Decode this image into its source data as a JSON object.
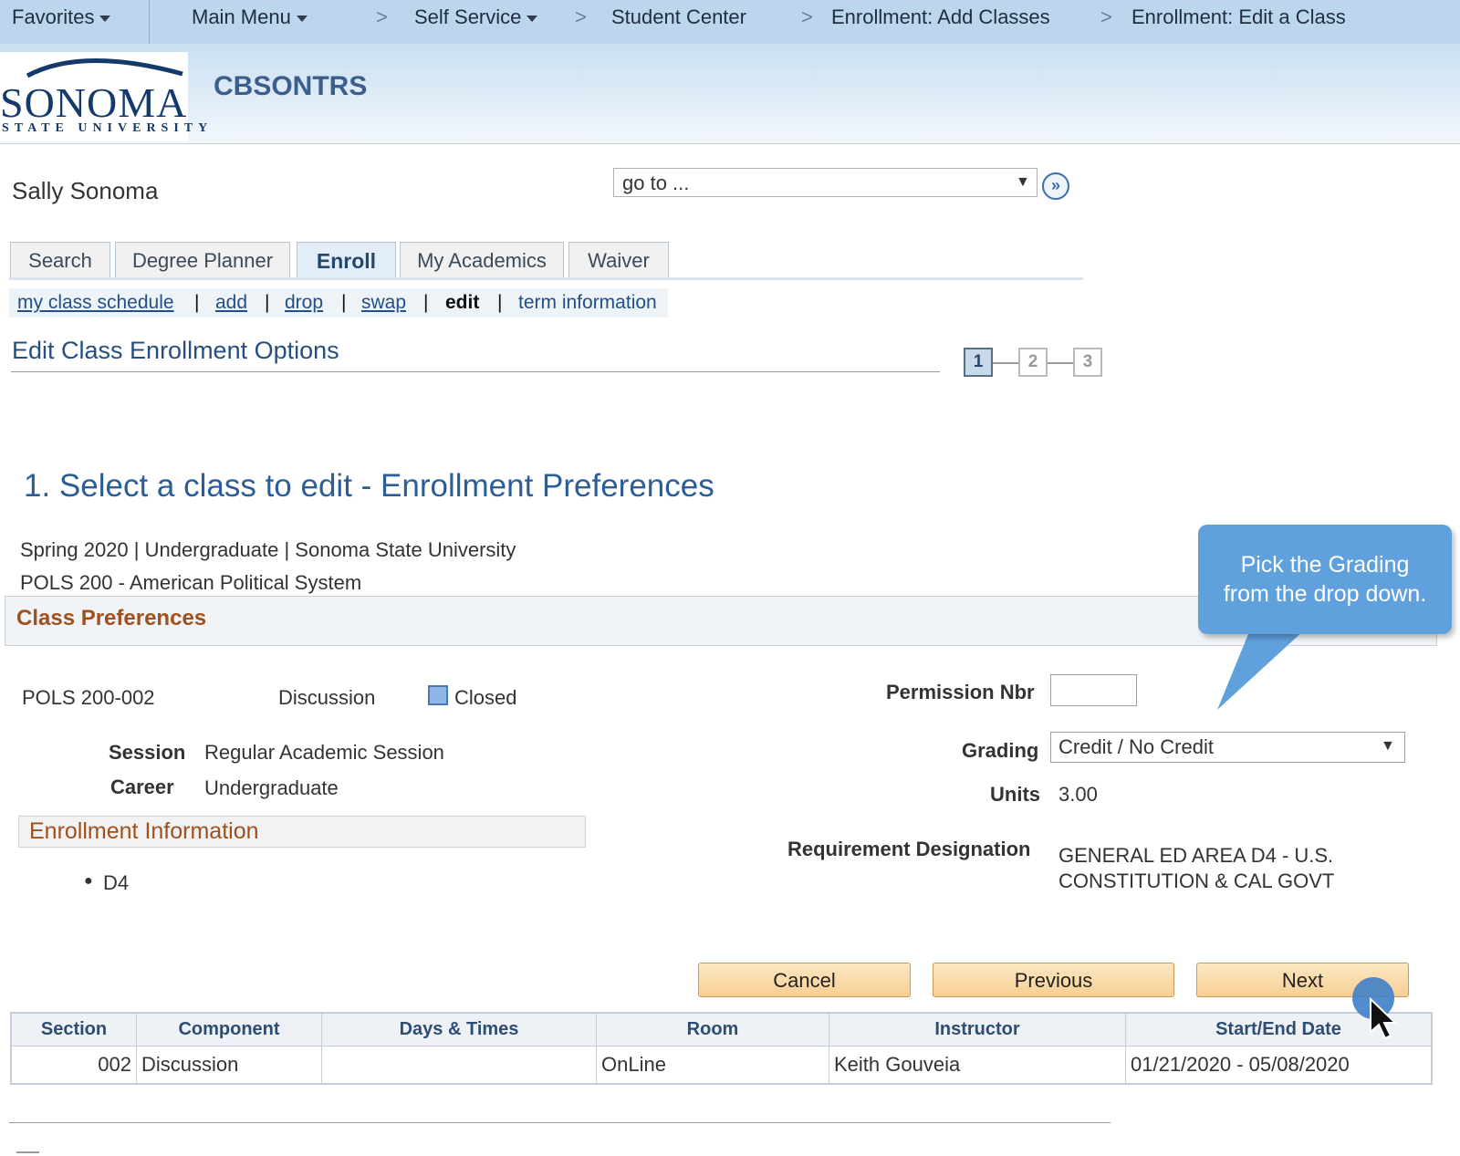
{
  "breadcrumb": {
    "favorites": "Favorites",
    "main_menu": "Main Menu",
    "self_service": "Self Service",
    "student_center": "Student Center",
    "add_classes": "Enrollment: Add Classes",
    "edit_class": "Enrollment: Edit a Class",
    "separator": ">"
  },
  "header": {
    "logo_word": "SONOMA",
    "logo_sub": "STATE UNIVERSITY",
    "system_title": "CBSONTRS"
  },
  "student": {
    "name": "Sally Sonoma",
    "goto_placeholder": "go to ...",
    "goto_arrow": "▼",
    "goto_button": "»"
  },
  "tabs": [
    {
      "label": "Search"
    },
    {
      "label": "Degree Planner"
    },
    {
      "label": "Enroll"
    },
    {
      "label": "My Academics"
    },
    {
      "label": "Waiver"
    }
  ],
  "subnav": {
    "schedule": "my class schedule",
    "add": "add",
    "drop": "drop",
    "swap": "swap",
    "edit": "edit",
    "term_info": "term information",
    "pipe": "|"
  },
  "page": {
    "title": "Edit Class Enrollment Options",
    "steps": [
      "1",
      "2",
      "3"
    ],
    "section_title": "1.  Select a class to edit - Enrollment Preferences",
    "term_line": "Spring 2020 | Undergraduate | Sonoma State University",
    "course_line": "POLS  200 - American Political System"
  },
  "preferences": {
    "title": "Class Preferences",
    "class_section": "POLS  200-002",
    "component": "Discussion",
    "status": "Closed",
    "session_label": "Session",
    "session_value": "Regular Academic Session",
    "career_label": "Career",
    "career_value": "Undergraduate",
    "enrollment_info_title": "Enrollment Information",
    "enrollment_info_item": "D4",
    "permission_label": "Permission Nbr",
    "grading_label": "Grading",
    "grading_value": "Credit / No Credit",
    "grading_arrow": "▼",
    "units_label": "Units",
    "units_value": "3.00",
    "requirement_label": "Requirement Designation",
    "requirement_line1": "GENERAL ED AREA D4 - U.S.",
    "requirement_line2": "CONSTITUTION & CAL GOVT"
  },
  "buttons": {
    "cancel": "Cancel",
    "previous": "Previous",
    "next": "Next"
  },
  "table": {
    "headers": [
      "Section",
      "Component",
      "Days & Times",
      "Room",
      "Instructor",
      "Start/End Date"
    ],
    "rows": [
      [
        "002",
        "Discussion",
        "",
        "OnLine",
        "Keith Gouveia",
        "01/21/2020 - 05/08/2020"
      ]
    ]
  },
  "callout": {
    "line1": "Pick the Grading",
    "line2": "from the drop down."
  }
}
